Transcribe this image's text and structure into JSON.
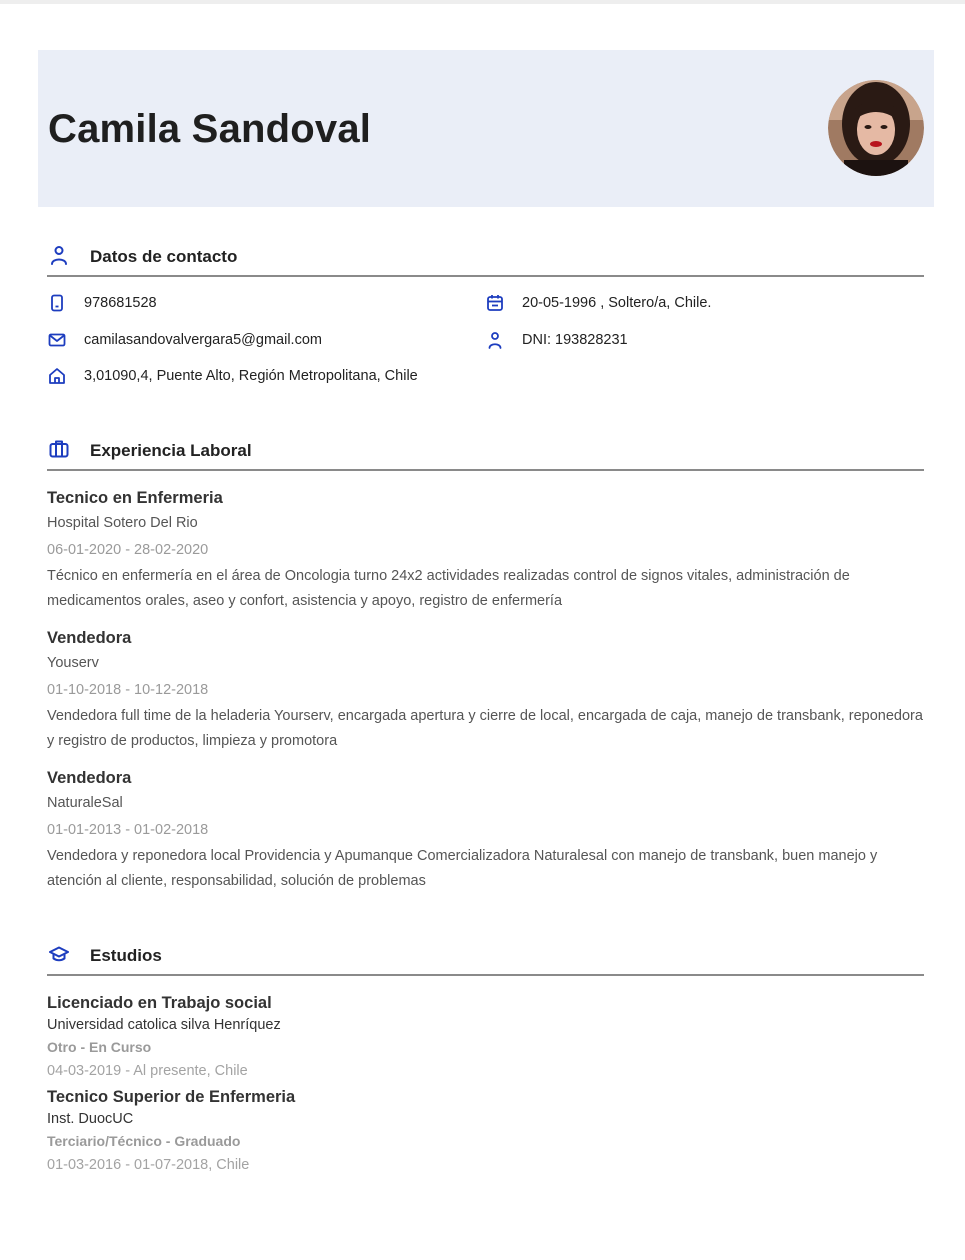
{
  "profile": {
    "name": "Camila Sandoval"
  },
  "colors": {
    "accent": "#1d3dbf",
    "header_bg": "#eaeef7",
    "rule": "#8a8a8a"
  },
  "sections": {
    "contact_title": "Datos de contacto",
    "experience_title": "Experiencia Laboral",
    "education_title": "Estudios"
  },
  "contact": {
    "phone": "978681528",
    "birth": "20-05-1996 , Soltero/a, Chile.",
    "email": "camilasandovalvergara5@gmail.com",
    "dni": "DNI: 193828231",
    "address": "3,01090,4, Puente Alto, Región Metropolitana, Chile",
    "icons": [
      "phone-icon",
      "calendar-icon",
      "mail-icon",
      "person-icon",
      "home-icon"
    ]
  },
  "experience": [
    {
      "title": "Tecnico en Enfermeria",
      "company": "Hospital Sotero Del Rio",
      "dates": "06-01-2020 - 28-02-2020",
      "desc1": "Técnico en enfermería en el área de Oncologia turno 24x2 actividades realizadas control de signos vitales, administración de",
      "desc2": "medicamentos orales, aseo y confort, asistencia y apoyo, registro de enfermería"
    },
    {
      "title": "Vendedora",
      "company": "Youserv",
      "dates": "01-10-2018 - 10-12-2018",
      "desc1": "Vendedora full time de la heladeria Yourserv, encargada apertura y cierre de local, encargada de caja, manejo de transbank, reponedora",
      "desc2": "y registro de productos, limpieza y promotora"
    },
    {
      "title": "Vendedora",
      "company": "NaturaleSal",
      "dates": "01-01-2013 - 01-02-2018",
      "desc1": "Vendedora y reponedora local Providencia y Apumanque Comercializadora Naturalesal con manejo de transbank, buen manejo y",
      "desc2": "atención al cliente, responsabilidad, solución de problemas"
    }
  ],
  "education": [
    {
      "degree": "Licenciado en Trabajo social",
      "institution": "Universidad catolica silva Henríquez",
      "level": "Otro - En Curso",
      "dates": "04-03-2019 - Al presente, Chile"
    },
    {
      "degree": "Tecnico Superior de Enfermeria",
      "institution": "Inst. DuocUC",
      "level": "Terciario/Técnico - Graduado",
      "dates": "01-03-2016 - 01-07-2018, Chile"
    }
  ]
}
